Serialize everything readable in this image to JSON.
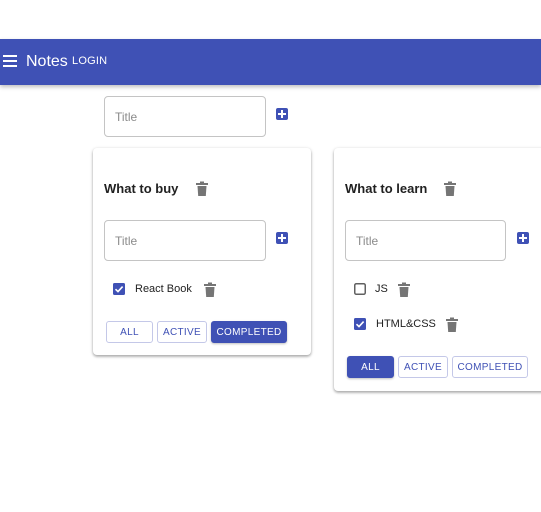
{
  "appbar": {
    "title": "Notes",
    "login_label": "LOGIN"
  },
  "new_list": {
    "placeholder": "Title"
  },
  "lists": [
    {
      "title": "What to buy",
      "new_task_placeholder": "Title",
      "tasks": [
        {
          "label": "React Book",
          "done": true
        }
      ],
      "filters": {
        "all": "ALL",
        "active": "ACTIVE",
        "completed": "COMPLETED",
        "selected": "completed"
      }
    },
    {
      "title": "What to learn",
      "new_task_placeholder": "Title",
      "tasks": [
        {
          "label": "JS",
          "done": false
        },
        {
          "label": "HTML&CSS",
          "done": true
        }
      ],
      "filters": {
        "all": "ALL",
        "active": "ACTIVE",
        "completed": "COMPLETED",
        "selected": "all"
      }
    }
  ],
  "colors": {
    "primary": "#3f51b5",
    "icon_gray": "#757575"
  }
}
